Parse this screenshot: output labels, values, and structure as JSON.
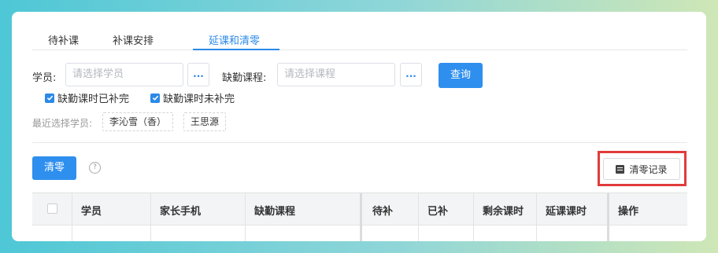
{
  "tabs": [
    {
      "label": "待补课"
    },
    {
      "label": "补课安排"
    },
    {
      "label": "延课和清零",
      "active": true
    }
  ],
  "filters": {
    "student_label": "学员:",
    "student_placeholder": "请选择学员",
    "course_label": "缺勤课程:",
    "course_placeholder": "请选择课程",
    "more_label": "...",
    "query_label": "查询",
    "checkboxes": [
      {
        "label": "缺勤课时已补完",
        "checked": true
      },
      {
        "label": "缺勤课时未补完",
        "checked": true
      }
    ]
  },
  "recent": {
    "label": "最近选择学员:",
    "students": [
      "李沁雪（香）",
      "王思源"
    ]
  },
  "actions": {
    "clear_label": "清零",
    "help_symbol": "?",
    "record_label": "清零记录"
  },
  "table": {
    "headers": [
      "学员",
      "家长手机",
      "缺勤课程",
      "待补",
      "已补",
      "剩余课时",
      "延课课时",
      "操作"
    ]
  },
  "colors": {
    "accent": "#2e8fee",
    "highlight": "#e23b3b"
  }
}
